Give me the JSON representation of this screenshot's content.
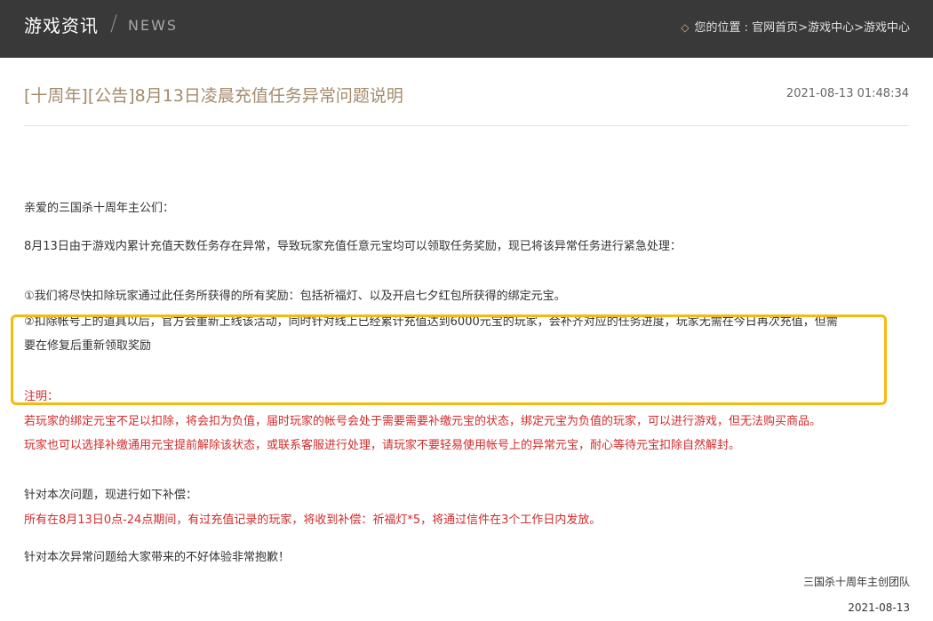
{
  "header": {
    "title": "游戏资讯",
    "slash": "/",
    "news": "NEWS",
    "location_icon": "◇",
    "location_prefix": "您的位置 : ",
    "breadcrumb": [
      "官网首页",
      ">",
      "游戏中心",
      ">",
      "游戏中心"
    ]
  },
  "article": {
    "title": "[十周年][公告]8月13日凌晨充值任务异常问题说明",
    "datetime": "2021-08-13 01:48:34"
  },
  "body": {
    "greeting": "亲爱的三国杀十周年主公们：",
    "intro": "8月13日由于游戏内累计充值天数任务存在异常，导致玩家充值任意元宝均可以领取任务奖励，现已将该异常任务进行紧急处理：",
    "item1": "①我们将尽快扣除玩家通过此任务所获得的所有奖励：包括祈福灯、以及开启七夕红包所获得的绑定元宝。",
    "item2_line1": "②扣除帐号上的道具以后，官方会重新上线该活动，同时针对线上已经累计充值达到6000元宝的玩家，会补齐对应的任务进度，玩家无需在今日再次充值，但需",
    "item2_line2": "要在修复后重新领取奖励",
    "note_label": "注明：",
    "note_line1": "若玩家的绑定元宝不足以扣除，将会扣为负值，届时玩家的帐号会处于需要需要补缴元宝的状态，绑定元宝为负值的玩家，可以进行游戏，但无法购买商品。",
    "note_line2": "玩家也可以选择补缴通用元宝提前解除该状态，或联系客服进行处理，请玩家不要轻易使用帐号上的异常元宝，耐心等待元宝扣除自然解封。",
    "compensation_intro": "针对本次问题，现进行如下补偿：",
    "compensation_detail": "所有在8月13日0点-24点期间，有过充值记录的玩家，将收到补偿：祈福灯*5，将通过信件在3个工作日内发放。",
    "apology": "针对本次异常问题给大家带来的不好体验非常抱歉！"
  },
  "signature": {
    "team": "三国杀十周年主创团队",
    "date": "2021-08-13"
  },
  "colors": {
    "header_bg": "#3a3939",
    "title_color": "#a48b6c",
    "warning_red": "#d12b2b",
    "highlight_box": "#f6b90e"
  }
}
